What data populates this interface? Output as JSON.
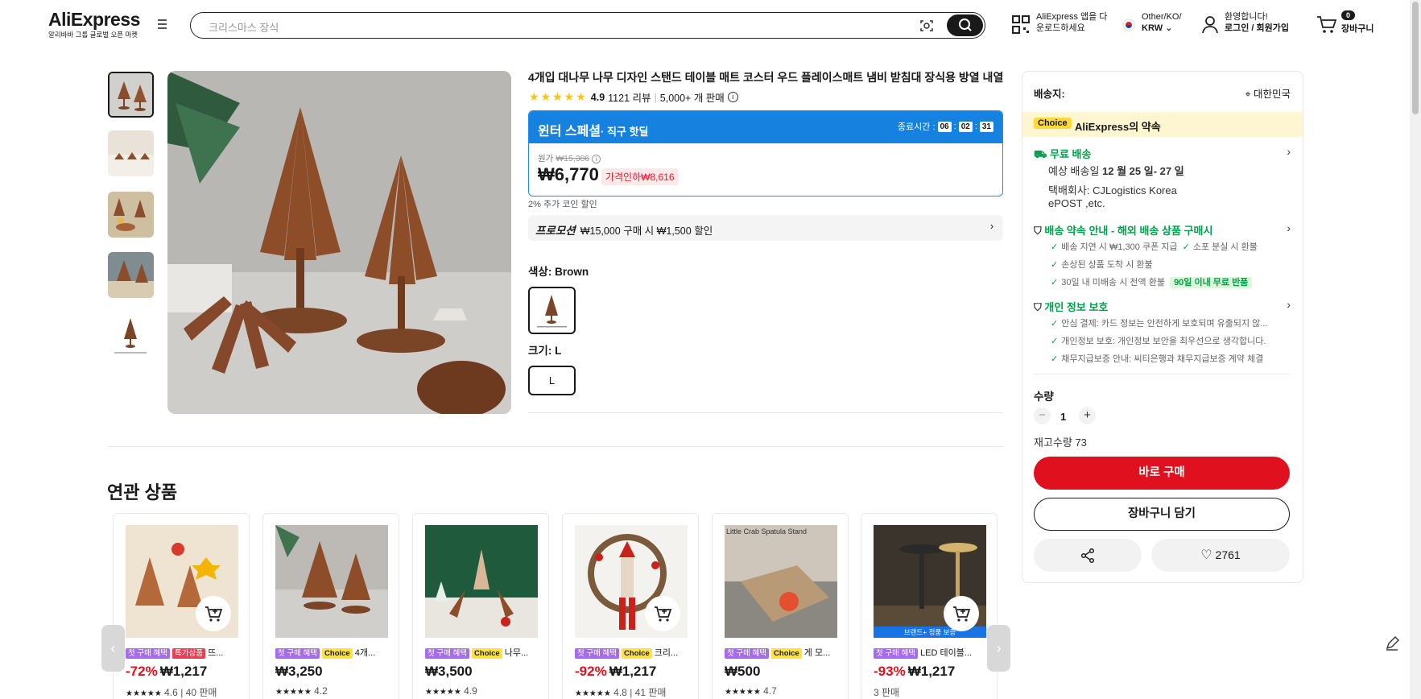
{
  "header": {
    "logo": "AliExpress",
    "logo_sub": "알리바바 그룹 글로벌 오픈 마켓",
    "search_placeholder": "크리스마스 장식",
    "app_line1": "AliExpress 앱을 다",
    "app_line2": "운로드하세요",
    "locale_line1": "Other/KO/",
    "locale_line2": "KRW",
    "user_line1": "환영합니다!",
    "user_line2": "로그인 / 회원가입",
    "cart_count": "0",
    "cart_label": "장바구니"
  },
  "product": {
    "title": "4개입 대나무 나무 디자인 스탠드 테이블 매트 코스터 우드 플레이스매트 냄비 받침대 장식용 방열 내열",
    "rating": "4.9",
    "reviews": "1121 리뷰",
    "sold": "5,000+ 개 판매",
    "deal_title": "윈터 스페셜",
    "deal_sub": "· 직구 핫딜",
    "timer_label": "종료시간 :",
    "timer_h": "06",
    "timer_m": "02",
    "timer_s": "31",
    "orig_label": "원가",
    "orig_price": "₩15,386",
    "price": "₩6,770",
    "price_drop": "가격인하₩8,616",
    "coin_note": "2% 추가 코인 할인",
    "promo_label": "프로모션",
    "promo_text": "₩15,000 구매 시 ₩1,500 할인",
    "color_label": "색상: Brown",
    "size_label": "크기: L",
    "size_value": "L"
  },
  "side": {
    "ship_to": "배송지:",
    "country": "대한민국",
    "choice_tag": "Choice",
    "choice_text": "AliExpress의 약속",
    "free_ship": "무료 배송",
    "est_prefix": "예상 배송일 ",
    "est_date": "12 월 25 일- 27 일",
    "carrier_line1": "택배회사:  CJLogistics  Korea",
    "carrier_line2": "ePOST ,etc.",
    "guarantee_title": "배송 약속 안내 - 해외 배송 상품 구매시",
    "g1": "배송 지연 시 ₩1,300 쿠폰 지급",
    "g2": "소포 분실 시 환불",
    "g3": "손상된 상품 도착 시 환불",
    "g4": "30일 내 미배송 시 전액 환불",
    "g4_tag": "90일 이내 무료 반품",
    "privacy_title": "개인 정보 보호",
    "p1": "안심 결제: 카드 정보는 안전하게 보호되며 유출되지 않...",
    "p2": "개인정보 보호: 개인정보 보안을 최우선으로 생각합니다.",
    "p3": "채무지급보증 안내: 씨티은행과 채무지급보증 계약 체결",
    "qty_label": "수량",
    "qty_value": "1",
    "stock": "재고수량 73",
    "buy_now": "바로 구매",
    "add_cart": "장바구니 담기",
    "wish_count": "2761"
  },
  "related": {
    "title": "연관 상품",
    "cards": [
      {
        "tag1": "첫 구매 혜택",
        "tag2": "특가상품",
        "tag2_type": "red",
        "name": "뜨...",
        "disc": "-72%",
        "price": "₩1,217",
        "rating": "4.6",
        "sold": "40 판매"
      },
      {
        "tag1": "첫 구매 혜택",
        "tag2": "Choice",
        "tag2_type": "yellow",
        "name": "4개...",
        "disc": "",
        "price": "₩3,250",
        "rating": "4.2",
        "sold": ""
      },
      {
        "tag1": "첫 구매 혜택",
        "tag2": "Choice",
        "tag2_type": "yellow",
        "name": "나무...",
        "disc": "",
        "price": "₩3,500",
        "rating": "4.9",
        "sold": ""
      },
      {
        "tag1": "첫 구매 혜택",
        "tag2": "Choice",
        "tag2_type": "yellow",
        "name": "크리...",
        "disc": "-92%",
        "price": "₩1,217",
        "rating": "4.8",
        "sold": "41 판매"
      },
      {
        "tag1": "첫 구매 혜택",
        "tag2": "Choice",
        "tag2_type": "yellow",
        "name": "게 모...",
        "disc": "",
        "price": "₩500",
        "rating": "4.7",
        "sold": ""
      },
      {
        "tag1": "첫 구매 혜택",
        "tag2": "",
        "tag2_type": "",
        "name": "LED 테이블...",
        "disc": "-93%",
        "price": "₩1,217",
        "rating": "",
        "sold": "3 판매"
      }
    ],
    "crab_caption": "Little Crab Spatula Stand",
    "brand_badge": "브랜드+ 정품 보증"
  }
}
